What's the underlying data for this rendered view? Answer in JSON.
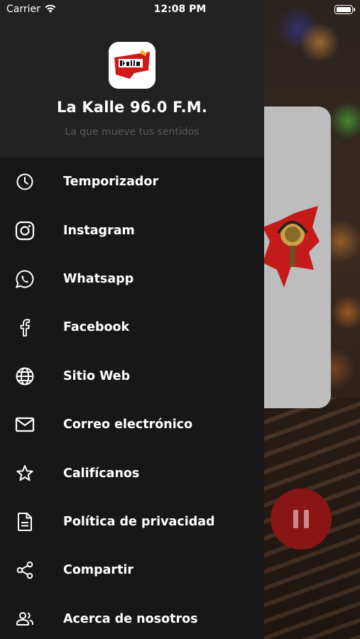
{
  "status_bar": {
    "carrier": "Carrier",
    "time": "12:08 PM"
  },
  "drawer": {
    "station_name": "La Kalle 96.0 F.M.",
    "tagline": "La que mueve tus sentidos",
    "logo_icon": "la-kalle-logo",
    "items": [
      {
        "label": "Temporizador",
        "icon": "clock-icon"
      },
      {
        "label": "Instagram",
        "icon": "instagram-icon"
      },
      {
        "label": "Whatsapp",
        "icon": "whatsapp-icon"
      },
      {
        "label": "Facebook",
        "icon": "facebook-icon"
      },
      {
        "label": "Sitio Web",
        "icon": "globe-icon"
      },
      {
        "label": "Correo electrónico",
        "icon": "mail-icon"
      },
      {
        "label": "Califícanos",
        "icon": "star-icon"
      },
      {
        "label": "Política de privacidad",
        "icon": "document-icon"
      },
      {
        "label": "Compartir",
        "icon": "share-icon"
      },
      {
        "label": "Acerca de nosotros",
        "icon": "people-icon"
      }
    ]
  },
  "player": {
    "state_icon": "pause-icon"
  },
  "colors": {
    "drawer_bg": "#171717",
    "header_bg": "#222222",
    "accent_red": "#8a1515",
    "text_primary": "#ffffff",
    "text_muted": "#595959"
  }
}
